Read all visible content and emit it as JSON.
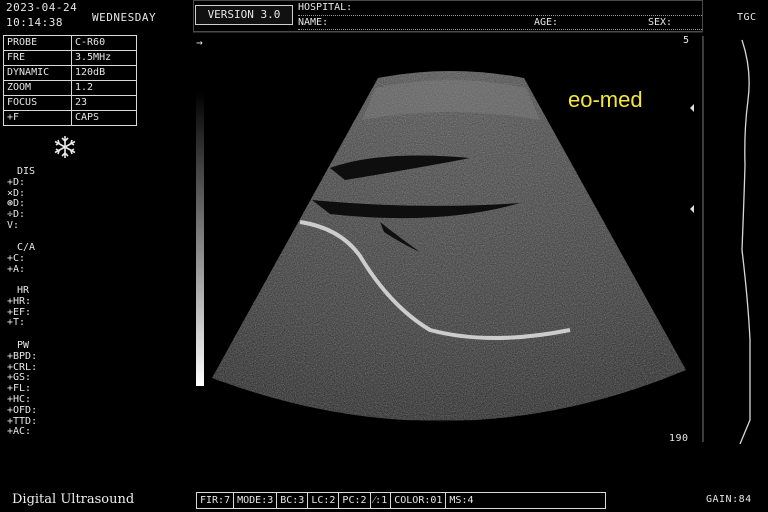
{
  "header": {
    "date": "2023-04-24",
    "time": "10:14:38",
    "weekday": "WEDNESDAY",
    "version": "VERSION 3.0",
    "hospital_label": "HOSPITAL:",
    "name_label": "NAME:",
    "age_label": "AGE:",
    "sex_label": "SEX:"
  },
  "params": [
    {
      "key": "PROBE",
      "value": "C-R60"
    },
    {
      "key": "FRE",
      "value": "3.5MHz"
    },
    {
      "key": "DYNAMIC",
      "value": "120dB"
    },
    {
      "key": "ZOOM",
      "value": "1.2"
    },
    {
      "key": "FOCUS",
      "value": "23"
    },
    {
      "key": "+F",
      "value": "CAPS"
    }
  ],
  "freeze_icon": "snowflake-icon",
  "measurements": {
    "dis": {
      "title": "DIS",
      "items": [
        "+D:",
        "×D:",
        "⊛D:",
        "÷D:",
        "V:"
      ]
    },
    "ca": {
      "title": "C/A",
      "items": [
        "+C:",
        "+A:"
      ]
    },
    "hr": {
      "title": "HR",
      "items": [
        "+HR:",
        "+EF:",
        "+T:"
      ]
    },
    "pw": {
      "title": "PW",
      "items": [
        "+BPD:",
        "+CRL:",
        "+GS:",
        "+FL:",
        "+HC:",
        "+OFD:",
        "+TTD:",
        "+AC:"
      ]
    }
  },
  "scale": {
    "depth_top": "5",
    "depth_bottom": "190",
    "tgc_label": "TGC"
  },
  "watermark": "eo-med",
  "footer": {
    "title": "Digital Ultrasound",
    "cells": [
      "FIR:7",
      "MODE:3",
      "BC:3",
      "LC:2",
      "PC:2",
      "⁄:1",
      "COLOR:01",
      "MS:4"
    ],
    "gain": "GAIN:84"
  },
  "colors": {
    "watermark": "#f5e63c",
    "background": "#000000"
  }
}
